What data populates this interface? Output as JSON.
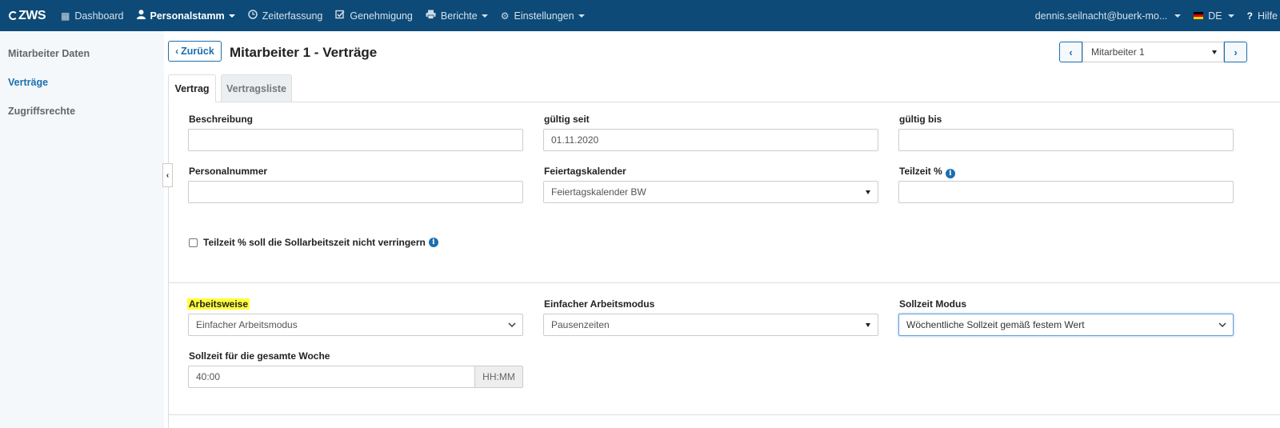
{
  "brand": {
    "logo_text": "ZWS"
  },
  "nav": {
    "items": [
      {
        "label": "Dashboard",
        "icon": "grid-icon"
      },
      {
        "label": "Personalstamm",
        "icon": "user-icon",
        "active": true,
        "dropdown": true
      },
      {
        "label": "Zeiterfassung",
        "icon": "clock-icon"
      },
      {
        "label": "Genehmigung",
        "icon": "check-square-icon"
      },
      {
        "label": "Berichte",
        "icon": "print-icon",
        "dropdown": true
      },
      {
        "label": "Einstellungen",
        "icon": "gear-icon",
        "dropdown": true
      }
    ],
    "user": "dennis.seilnacht@buerk-mo...",
    "language": "DE",
    "help": "Hilfe"
  },
  "sidebar": {
    "items": [
      {
        "label": "Mitarbeiter Daten"
      },
      {
        "label": "Verträge",
        "active": true
      },
      {
        "label": "Zugriffsrechte"
      }
    ]
  },
  "header": {
    "back_label": "Zurück",
    "title": "Mitarbeiter 1 - Verträge",
    "employee_select": "Mitarbeiter 1"
  },
  "tabs": [
    {
      "label": "Vertrag",
      "active": true
    },
    {
      "label": "Vertragsliste"
    }
  ],
  "form": {
    "beschreibung": {
      "label": "Beschreibung",
      "value": ""
    },
    "gueltig_seit": {
      "label": "gültig seit",
      "value": "01.11.2020"
    },
    "gueltig_bis": {
      "label": "gültig bis",
      "value": ""
    },
    "personalnummer": {
      "label": "Personalnummer",
      "value": ""
    },
    "feiertagskalender": {
      "label": "Feiertagskalender",
      "value": "Feiertagskalender BW"
    },
    "teilzeit": {
      "label": "Teilzeit %",
      "value": ""
    },
    "teilzeit_checkbox": {
      "label": "Teilzeit % soll die Sollarbeitszeit nicht verringern",
      "checked": false
    },
    "arbeitsweise": {
      "label": "Arbeitsweise",
      "value": "Einfacher Arbeitsmodus"
    },
    "arbeitsmodus": {
      "label": "Einfacher Arbeitsmodus",
      "value": "Pausenzeiten"
    },
    "sollzeit_modus": {
      "label": "Sollzeit Modus",
      "value": "Wöchentliche Sollzeit gemäß festem Wert"
    },
    "sollzeit_woche": {
      "label": "Sollzeit für die gesamte Woche",
      "value": "40:00",
      "unit": "HH:MM"
    }
  },
  "colors": {
    "navbar": "#0d4a77",
    "accent": "#1a6fb0",
    "highlight": "#ffff3a"
  }
}
